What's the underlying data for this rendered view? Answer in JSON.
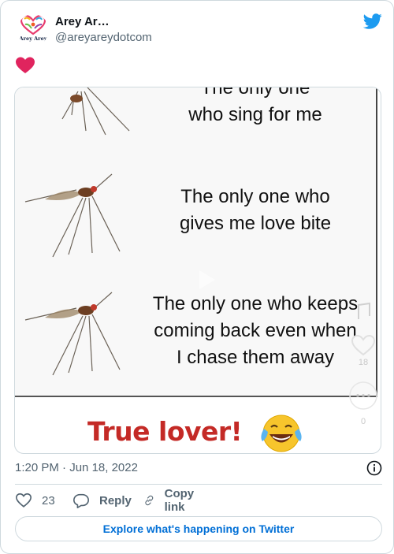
{
  "author": {
    "display_name": "Arey Ar…",
    "handle": "@areyareydotcom",
    "avatar_text": "Arey Arey"
  },
  "tweet": {
    "text_emoji": "❤️"
  },
  "media": {
    "captions": [
      "The only one\nwho sing for me",
      "The only one who\ngives me love bite",
      "The only one who keeps\ncoming back even when\nI chase them away"
    ],
    "punchline": "True lover!",
    "punchline_emoji": "😂",
    "overlay_counts": [
      "18",
      "0"
    ]
  },
  "meta": {
    "time": "1:20 PM",
    "separator": "·",
    "date": "Jun 18, 2022"
  },
  "actions": {
    "like_count": "23",
    "reply_label": "Reply",
    "copy_label": "Copy link"
  },
  "explore_label": "Explore what's happening on Twitter",
  "colors": {
    "twitter_blue": "#1d9bf0",
    "heart_red": "#e0245e",
    "punchline_red": "#c42a26"
  }
}
